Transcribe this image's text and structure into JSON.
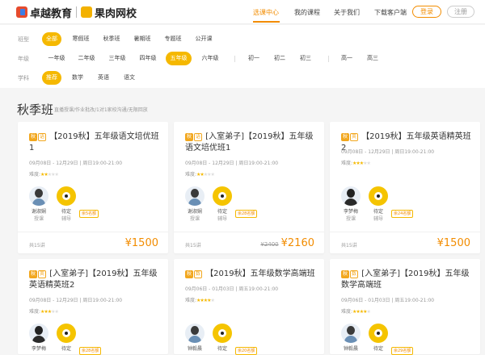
{
  "header": {
    "logo_text_1": "卓越教育",
    "logo_text_2": "果肉网校",
    "nav": [
      "选课中心",
      "我的课程",
      "关于我们",
      "下载客户端"
    ],
    "login_label": "登录",
    "register_label": "注册"
  },
  "filters": {
    "class_type": {
      "label": "班型",
      "options": [
        "全部",
        "寒假班",
        "秋季班",
        "暑期班",
        "专题班",
        "公开课"
      ],
      "selected": "全部"
    },
    "grade": {
      "label": "年级",
      "options": [
        "一年级",
        "二年级",
        "三年级",
        "四年级",
        "五年级",
        "六年级",
        "初一",
        "初二",
        "初三",
        "高一",
        "高三"
      ],
      "selected": "五年级"
    },
    "subject": {
      "label": "学科",
      "options": [
        "推荐",
        "数学",
        "英语",
        "语文"
      ],
      "selected": "推荐"
    }
  },
  "section": {
    "title": "秋季班",
    "subtitle": "直播授课/作业批改/1对1家校沟通/无限回放"
  },
  "cards": [
    {
      "season_tag": "秋",
      "subject_tag": "语",
      "title": "【2019秋】五年级语文培优班1",
      "date": "09月08日 - 12月29日 | 周日19:00-21:00",
      "difficulty_label": "难度:",
      "difficulty": 2,
      "teacher": {
        "name": "谢淑娴",
        "role": "授课"
      },
      "tutor": {
        "name": "待定",
        "role": "辅导"
      },
      "seats": "余5名额",
      "lessons": "共15讲",
      "old_price": "",
      "price": "¥1500"
    },
    {
      "season_tag": "秋",
      "subject_tag": "语",
      "title": "[入室弟子]【2019秋】五年级语文培优班1",
      "date": "09月08日 - 12月29日 | 周日19:00-21:00",
      "difficulty_label": "难度:",
      "difficulty": 2,
      "teacher": {
        "name": "谢淑娴",
        "role": "授课"
      },
      "tutor": {
        "name": "待定",
        "role": "辅导"
      },
      "seats": "余28名额",
      "lessons": "共15讲",
      "old_price": "¥2400",
      "price": "¥2160"
    },
    {
      "season_tag": "秋",
      "subject_tag": "英",
      "title": "【2019秋】五年级英语精英班2",
      "date": "09月08日 - 12月29日 | 周日19:00-21:00",
      "difficulty_label": "难度:",
      "difficulty": 3,
      "teacher": {
        "name": "李梦梅",
        "role": "授课"
      },
      "tutor": {
        "name": "待定",
        "role": "辅导"
      },
      "seats": "余24名额",
      "lessons": "共15讲",
      "old_price": "",
      "price": "¥1500"
    },
    {
      "season_tag": "秋",
      "subject_tag": "英",
      "title": "[入室弟子]【2019秋】五年级英语精英班2",
      "date": "09月08日 - 12月29日 | 周日19:00-21:00",
      "difficulty_label": "难度:",
      "difficulty": 3,
      "teacher": {
        "name": "李梦梅",
        "role": "授课"
      },
      "tutor": {
        "name": "待定",
        "role": "辅导"
      },
      "seats": "余28名额",
      "lessons": "",
      "old_price": "",
      "price": ""
    },
    {
      "season_tag": "秋",
      "subject_tag": "数",
      "title": "【2019秋】五年级数学高端班",
      "date": "09月06日 - 01月03日 | 周五19:00-21:00",
      "difficulty_label": "难度:",
      "difficulty": 4,
      "teacher": {
        "name": "钟毅晨",
        "role": "授课"
      },
      "tutor": {
        "name": "待定",
        "role": "辅导"
      },
      "seats": "余20名额",
      "lessons": "",
      "old_price": "",
      "price": ""
    },
    {
      "season_tag": "秋",
      "subject_tag": "数",
      "title": "[入室弟子]【2019秋】五年级数学高端班",
      "date": "09月06日 - 01月03日 | 周五19:00-21:00",
      "difficulty_label": "难度:",
      "difficulty": 4,
      "teacher": {
        "name": "钟毅晨",
        "role": "授课"
      },
      "tutor": {
        "name": "待定",
        "role": "辅导"
      },
      "seats": "余29名额",
      "lessons": "",
      "old_price": "",
      "price": ""
    }
  ]
}
